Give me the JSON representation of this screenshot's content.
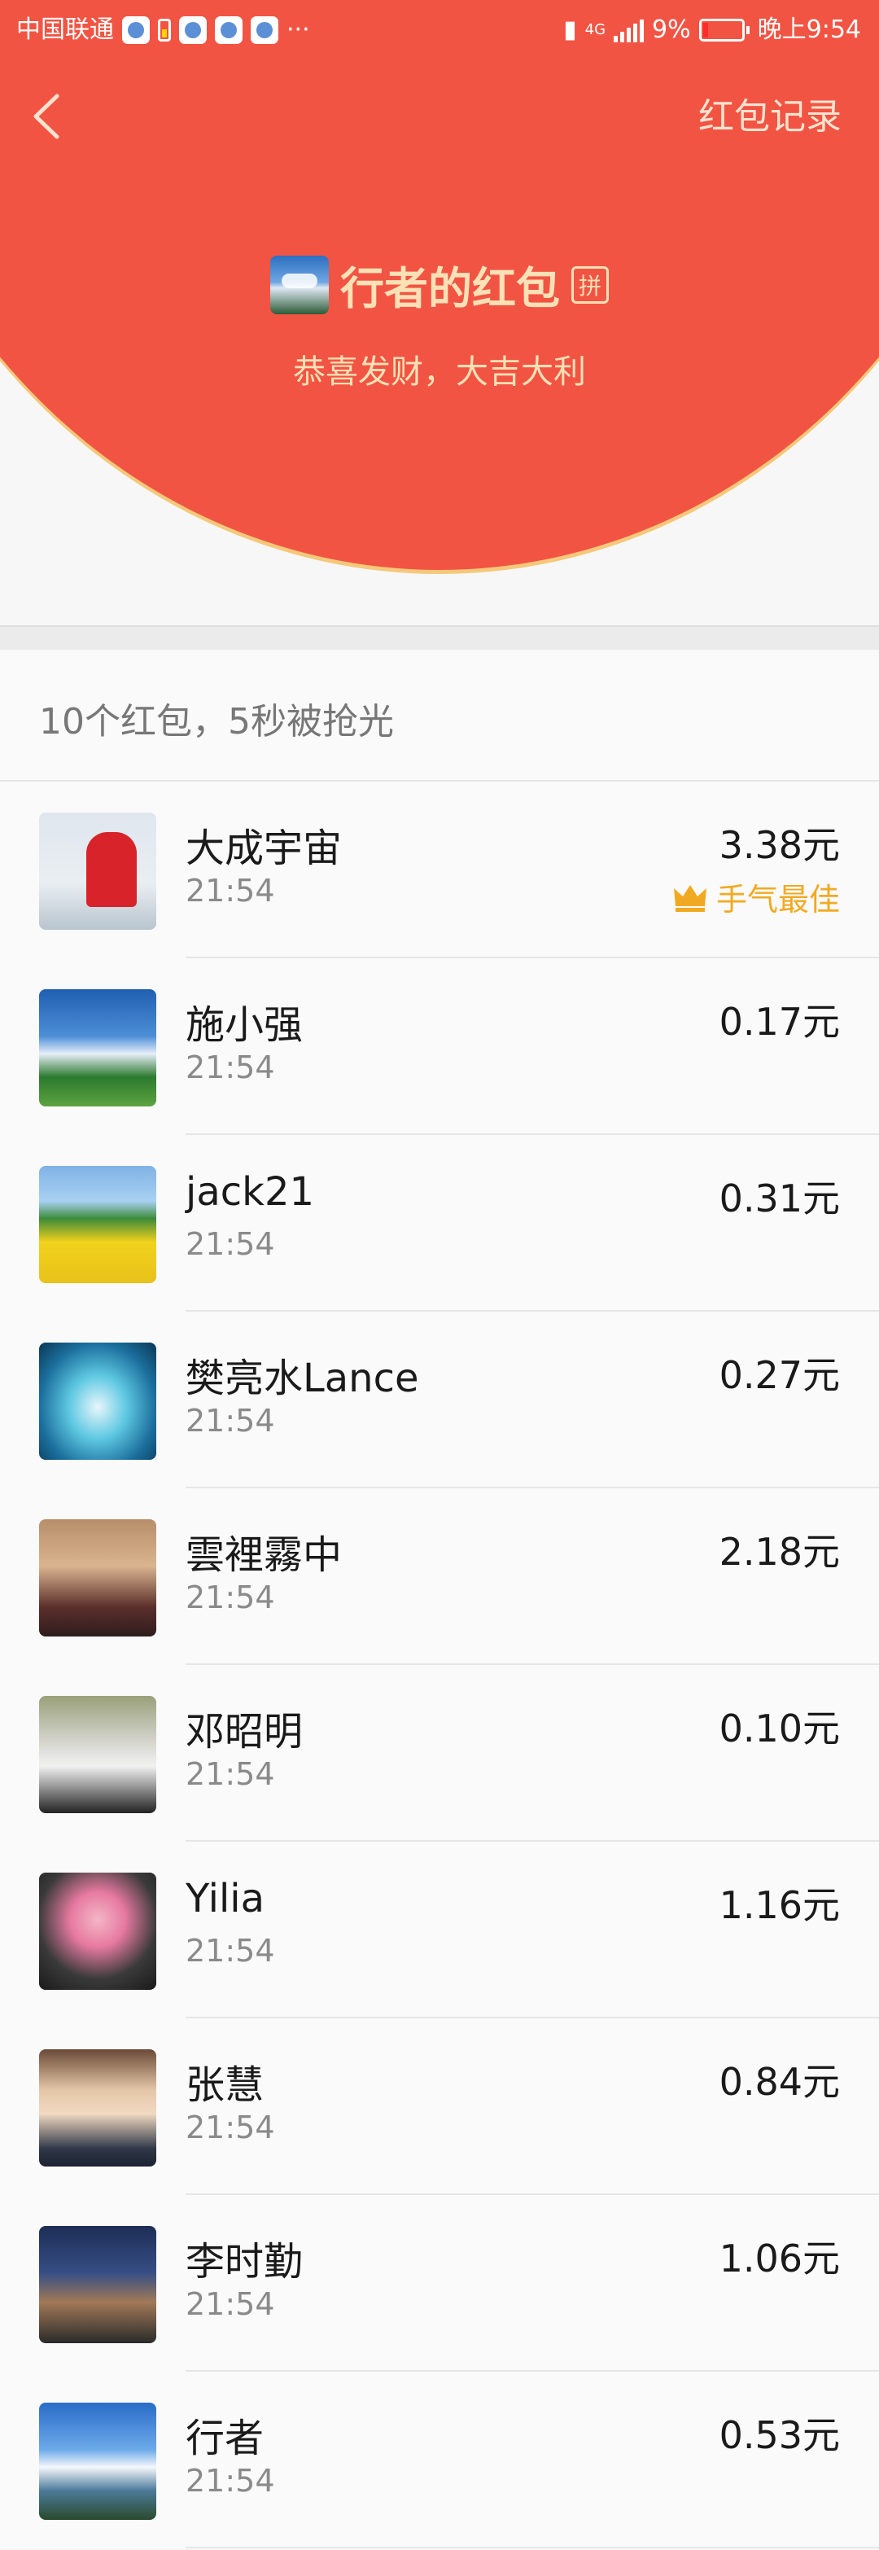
{
  "status_bar": {
    "carrier": "中国联通",
    "more": "···",
    "network": "4G",
    "battery": "9%",
    "time": "晚上9:54"
  },
  "header": {
    "back_icon": "chevron-left-icon",
    "record_link": "红包记录",
    "title": "行者的红包",
    "pin_badge": "拼",
    "subtitle": "恭喜发财，大吉大利"
  },
  "summary": "10个红包，5秒被抢光",
  "best_label": "手气最佳",
  "list": [
    {
      "name": "大成宇宙",
      "time": "21:54",
      "amount": "3.38元",
      "best": true
    },
    {
      "name": "施小强",
      "time": "21:54",
      "amount": "0.17元",
      "best": false
    },
    {
      "name": "jack21",
      "time": "21:54",
      "amount": "0.31元",
      "best": false
    },
    {
      "name": "樊亮水Lance",
      "time": "21:54",
      "amount": "0.27元",
      "best": false
    },
    {
      "name": "雲裡霧中",
      "time": "21:54",
      "amount": "2.18元",
      "best": false
    },
    {
      "name": "邓昭明",
      "time": "21:54",
      "amount": "0.10元",
      "best": false
    },
    {
      "name": "Yilia",
      "time": "21:54",
      "amount": "1.16元",
      "best": false
    },
    {
      "name": "张慧",
      "time": "21:54",
      "amount": "0.84元",
      "best": false
    },
    {
      "name": "李时勤",
      "time": "21:54",
      "amount": "1.06元",
      "best": false
    },
    {
      "name": "行者",
      "time": "21:54",
      "amount": "0.53元",
      "best": false
    }
  ],
  "colors": {
    "header_red": "#f25443",
    "gold_text": "#fde1b6",
    "best_orange": "#f2a922"
  }
}
